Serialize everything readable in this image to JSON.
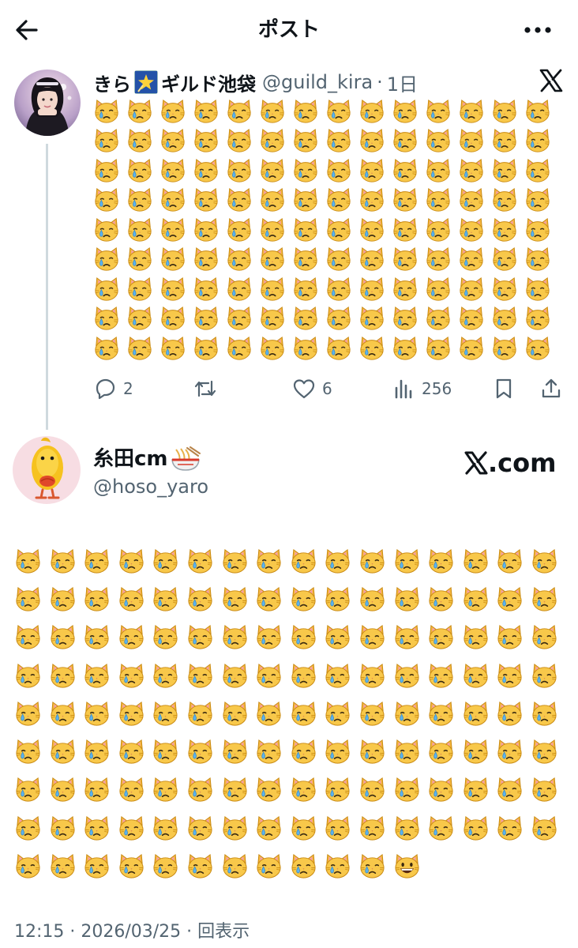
{
  "header": {
    "title": "ポスト"
  },
  "tweet1": {
    "name": "きら",
    "name_suffix": "ギルド池袋",
    "handle": "@guild_kira",
    "separator": "·",
    "time": "1日",
    "grid": {
      "columns": 14,
      "rows": 9,
      "emoji": "😿"
    },
    "actions": {
      "replies": "2",
      "retweets": "",
      "likes": "6",
      "views": "256"
    }
  },
  "tweet2": {
    "name": "糸田cm",
    "handle": "@hoso_yaro",
    "link_label": ".com",
    "grid": {
      "columns": 16,
      "full_rows": 8,
      "last_row_count": 11,
      "emoji": "😿",
      "final_emoji": "😃"
    },
    "meta": "12:15 · 2026/03/25 · 回表示"
  },
  "colors": {
    "text": "#0f1419",
    "secondary": "#536471",
    "thread_line": "#cfd9de",
    "background": "#ffffff"
  },
  "icons": [
    "back-arrow-icon",
    "more-icon",
    "x-logo-icon",
    "reply-icon",
    "retweet-icon",
    "like-icon",
    "views-icon",
    "bookmark-icon",
    "share-icon",
    "star-icon",
    "noodle-icon"
  ]
}
